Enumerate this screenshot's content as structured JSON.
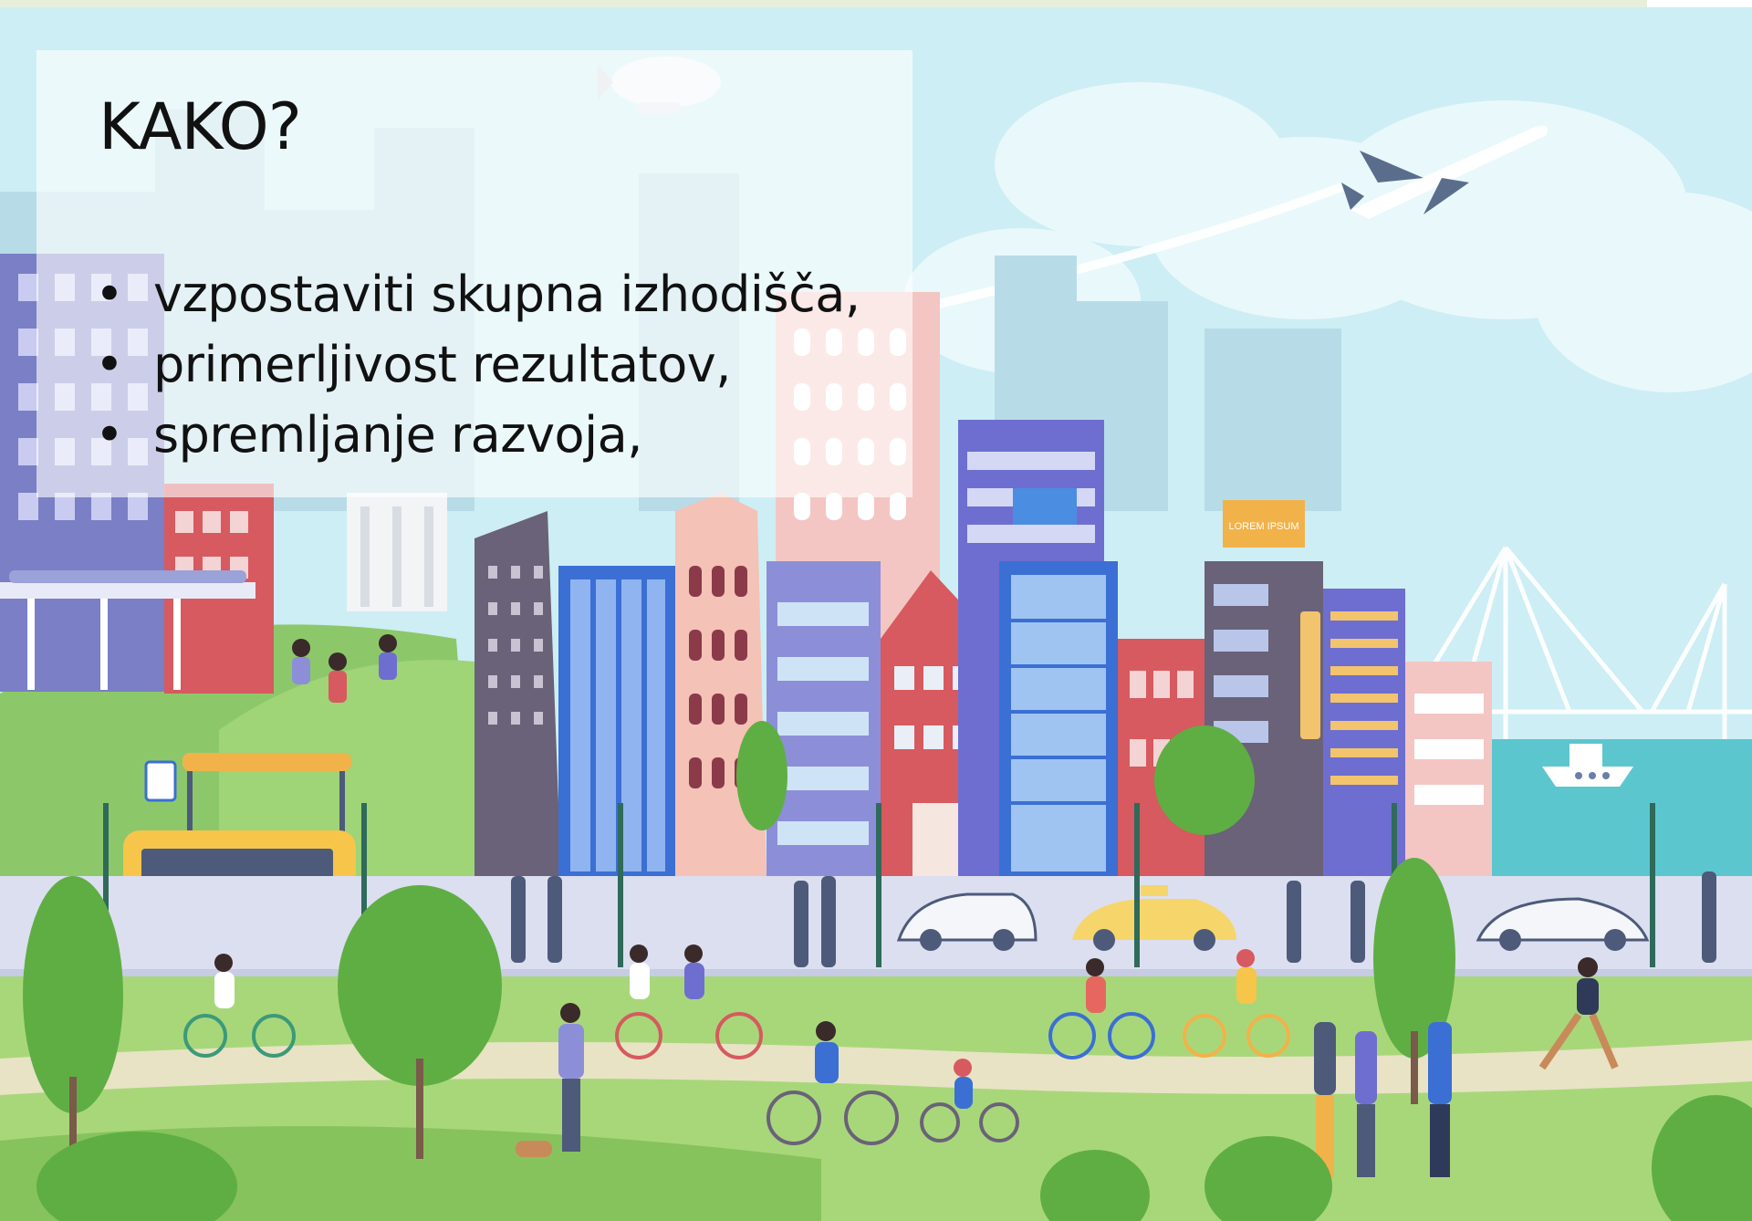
{
  "slide": {
    "title": "KAKO?",
    "bullets": [
      "vzpostaviti skupna izhodišča,",
      "primerljivost rezultatov,",
      "spremljanje razvoja,"
    ]
  },
  "illustration": {
    "subject": "city-illustration",
    "billboard_text": "LOREM IPSUM",
    "colors": {
      "sky": "#c8ecf2",
      "grass": "#9fcf6a",
      "road": "#dcdff0",
      "water": "#5cc6cf"
    }
  }
}
